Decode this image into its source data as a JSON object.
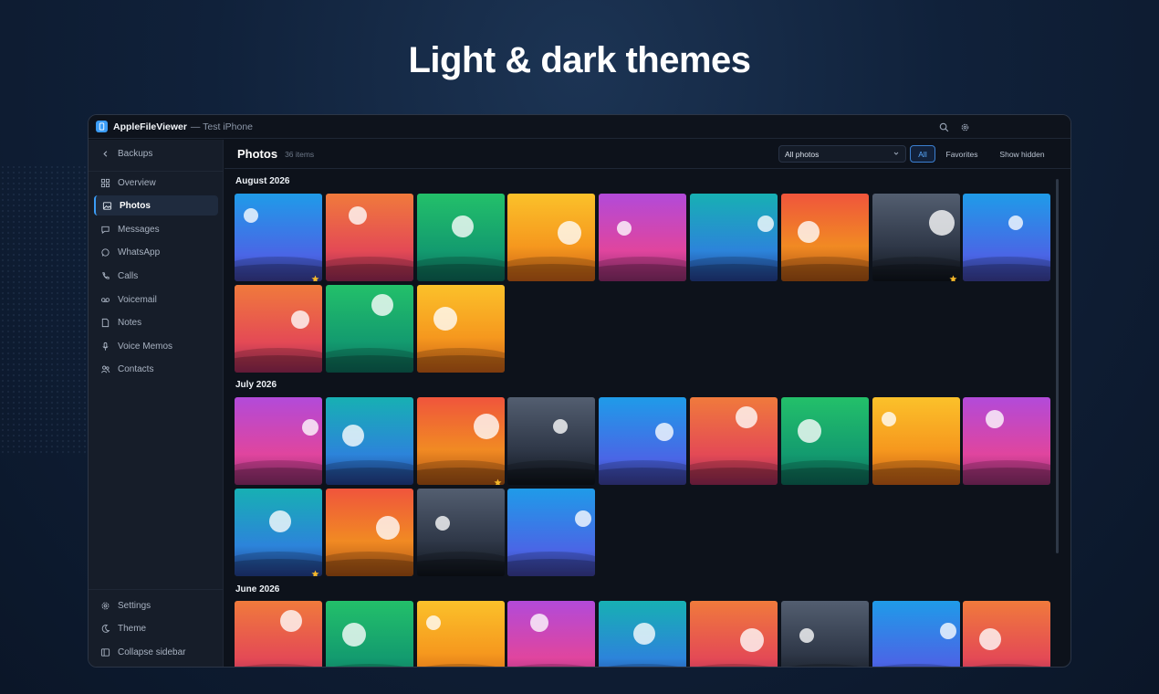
{
  "headline": "Light & dark themes",
  "window": {
    "app_name": "AppleFileViewer",
    "device": "— Test iPhone",
    "accent": "#3b9cf5"
  },
  "sidebar": {
    "back_label": "Backups",
    "items": [
      {
        "label": "Overview",
        "icon": "grid-icon"
      },
      {
        "label": "Photos",
        "icon": "image-icon",
        "active": true
      },
      {
        "label": "Messages",
        "icon": "message-icon"
      },
      {
        "label": "WhatsApp",
        "icon": "whatsapp-icon"
      },
      {
        "label": "Calls",
        "icon": "phone-icon"
      },
      {
        "label": "Voicemail",
        "icon": "voicemail-icon"
      },
      {
        "label": "Notes",
        "icon": "note-icon"
      },
      {
        "label": "Voice Memos",
        "icon": "mic-icon"
      },
      {
        "label": "Contacts",
        "icon": "people-icon"
      }
    ],
    "footer": [
      {
        "label": "Settings",
        "icon": "gear-icon"
      },
      {
        "label": "Theme",
        "icon": "moon-icon"
      },
      {
        "label": "Collapse sidebar",
        "icon": "sidebar-icon"
      }
    ]
  },
  "toolbar": {
    "title": "Photos",
    "count": "36 items",
    "filter_value": "All photos",
    "buttons": [
      "All",
      "Favorites",
      "Show hidden"
    ],
    "active_button": "All"
  },
  "sections": [
    {
      "title": "August 2026",
      "photos": [
        {
          "color": "blue",
          "favorite": true
        },
        {
          "color": "red",
          "favorite": false
        },
        {
          "color": "green",
          "favorite": false
        },
        {
          "color": "yellow",
          "favorite": false
        },
        {
          "color": "purple",
          "favorite": false
        },
        {
          "color": "teal",
          "favorite": false
        },
        {
          "color": "orange",
          "favorite": false
        },
        {
          "color": "gray",
          "favorite": true
        },
        {
          "color": "blue",
          "favorite": false
        },
        {
          "color": "red",
          "favorite": false
        },
        {
          "color": "green",
          "favorite": false
        },
        {
          "color": "yellow",
          "favorite": false
        }
      ]
    },
    {
      "title": "July 2026",
      "photos": [
        {
          "color": "purple",
          "favorite": false
        },
        {
          "color": "teal",
          "favorite": false
        },
        {
          "color": "orange",
          "favorite": true
        },
        {
          "color": "gray",
          "favorite": false
        },
        {
          "color": "blue",
          "favorite": false
        },
        {
          "color": "red",
          "favorite": false
        },
        {
          "color": "green",
          "favorite": false
        },
        {
          "color": "yellow",
          "favorite": false
        },
        {
          "color": "purple",
          "favorite": false
        },
        {
          "color": "teal",
          "favorite": true
        },
        {
          "color": "orange",
          "favorite": false
        },
        {
          "color": "gray",
          "favorite": false
        },
        {
          "color": "blue",
          "favorite": false
        }
      ]
    },
    {
      "title": "June 2026",
      "photos": [
        {
          "color": "red",
          "favorite": false
        },
        {
          "color": "green",
          "favorite": false
        },
        {
          "color": "yellow",
          "favorite": false
        },
        {
          "color": "purple",
          "favorite": false
        },
        {
          "color": "teal",
          "favorite": false
        },
        {
          "color": "red",
          "favorite": false
        },
        {
          "color": "gray",
          "favorite": false
        },
        {
          "color": "blue",
          "favorite": false
        },
        {
          "color": "red",
          "favorite": false
        }
      ]
    }
  ]
}
